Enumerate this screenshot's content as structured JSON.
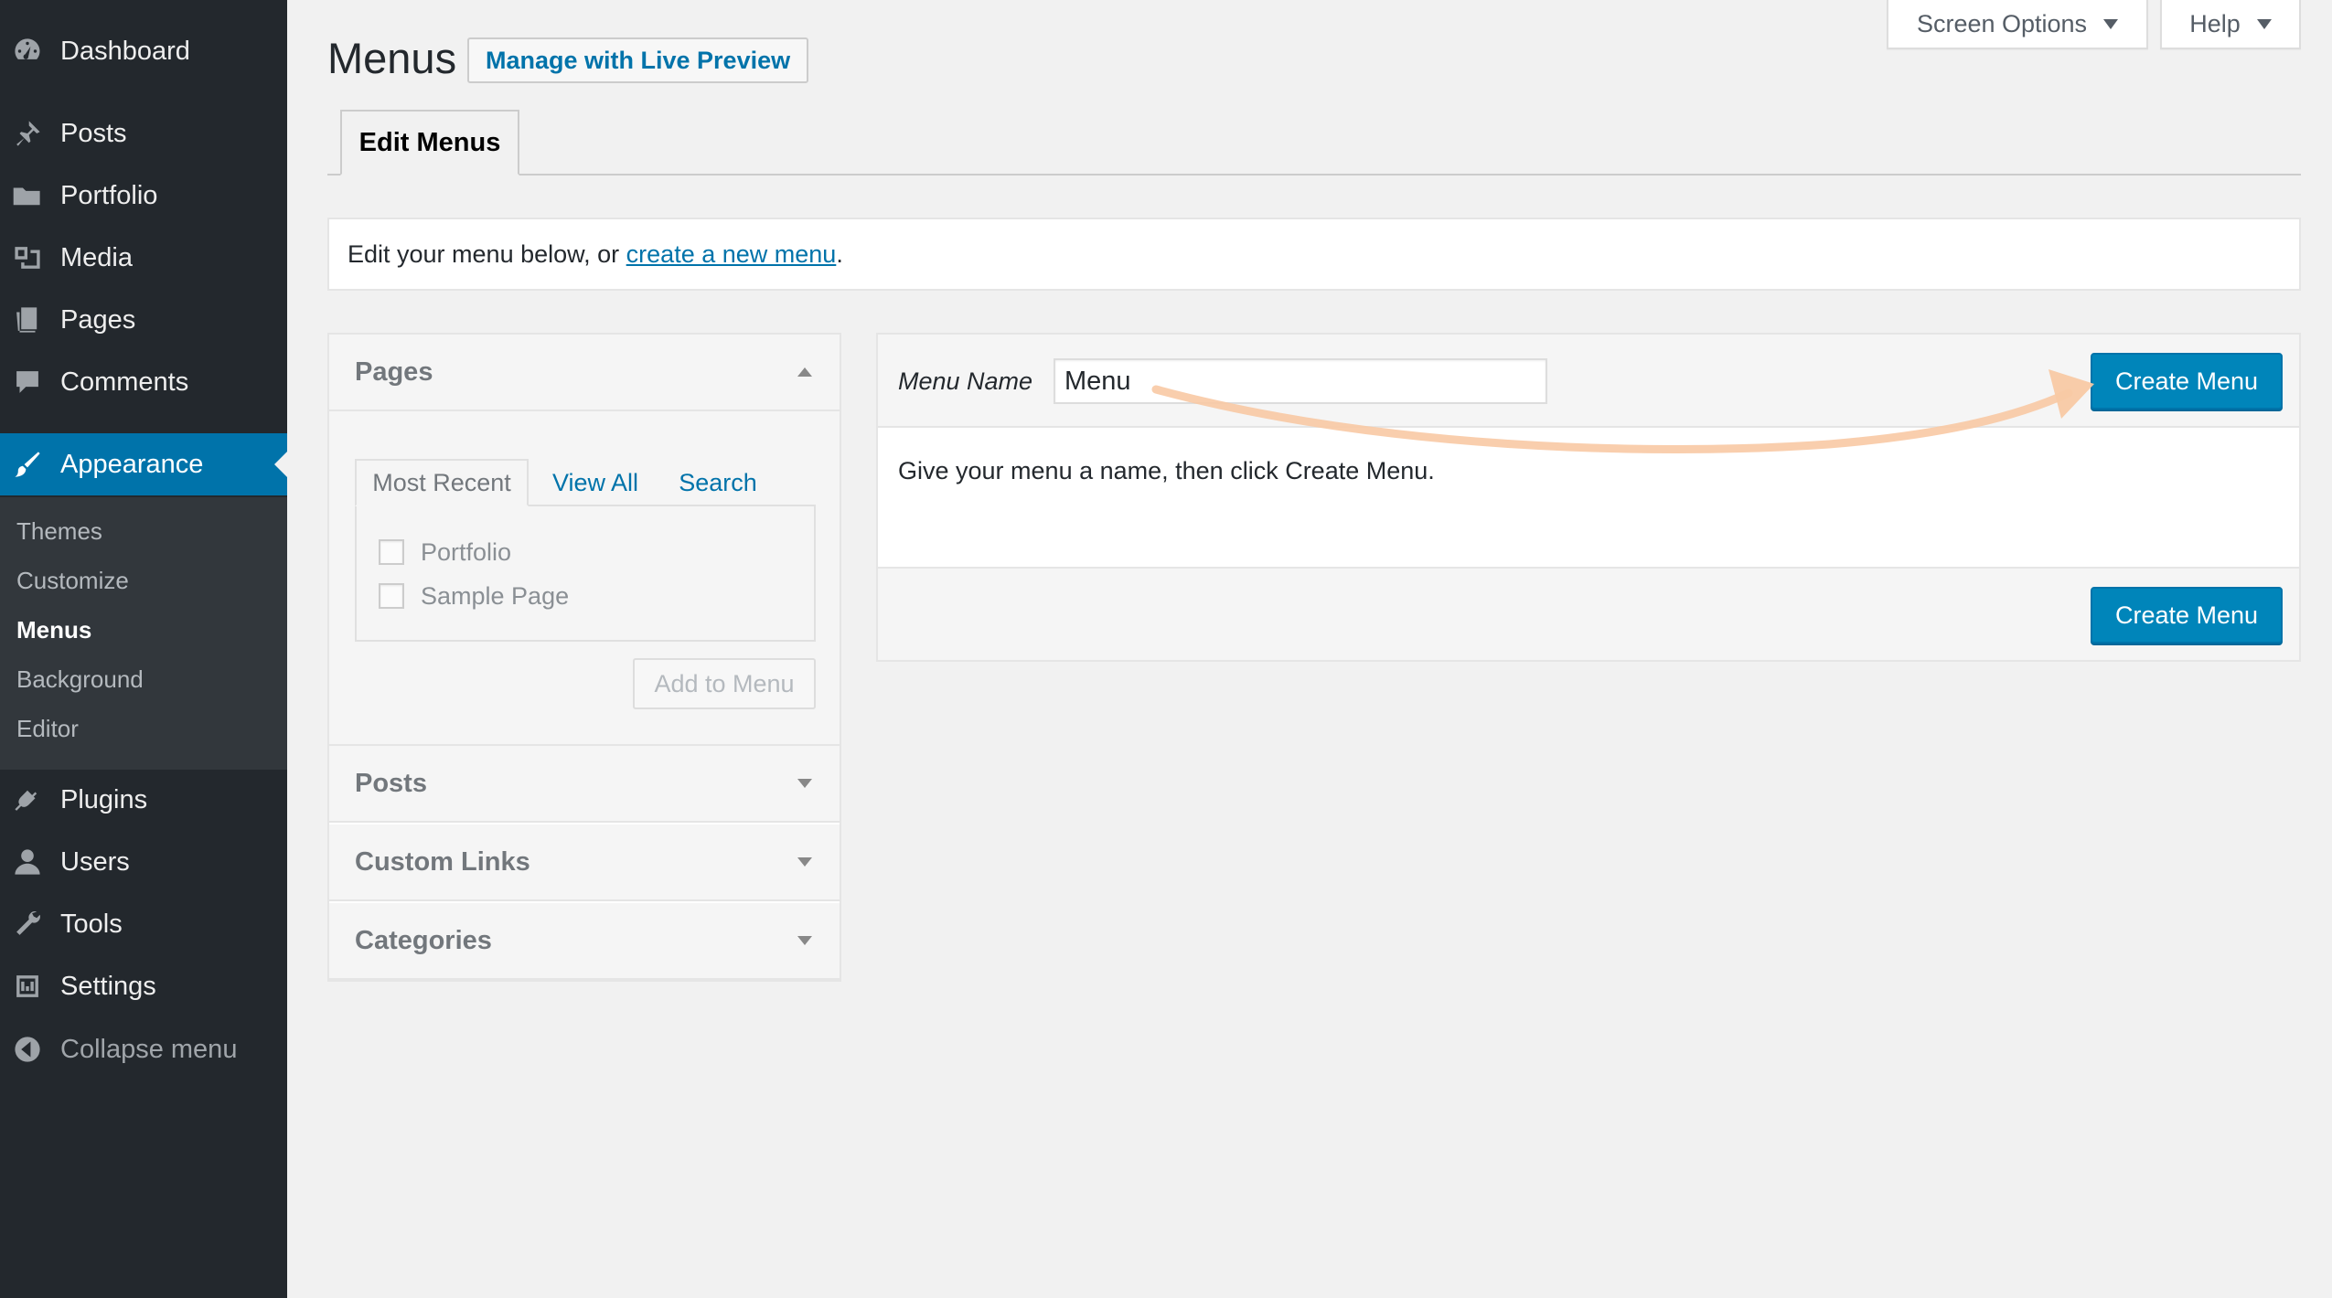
{
  "sidebar": {
    "items": [
      {
        "label": "Dashboard",
        "icon": "dashboard-icon"
      },
      {
        "label": "Posts",
        "icon": "pin-icon"
      },
      {
        "label": "Portfolio",
        "icon": "folder-icon"
      },
      {
        "label": "Media",
        "icon": "media-icon"
      },
      {
        "label": "Pages",
        "icon": "pages-icon"
      },
      {
        "label": "Comments",
        "icon": "comment-icon"
      },
      {
        "label": "Appearance",
        "icon": "brush-icon"
      },
      {
        "label": "Plugins",
        "icon": "plugin-icon"
      },
      {
        "label": "Users",
        "icon": "user-icon"
      },
      {
        "label": "Tools",
        "icon": "wrench-icon"
      },
      {
        "label": "Settings",
        "icon": "settings-icon"
      }
    ],
    "submenu": [
      "Themes",
      "Customize",
      "Menus",
      "Background",
      "Editor"
    ],
    "collapse_label": "Collapse menu"
  },
  "screen_meta": {
    "screen_options": "Screen Options",
    "help": "Help"
  },
  "header": {
    "title": "Menus",
    "live_preview": "Manage with Live Preview",
    "tab": "Edit Menus"
  },
  "notice": {
    "prefix": "Edit your menu below, or ",
    "link": "create a new menu",
    "suffix": "."
  },
  "accordion": {
    "pages_title": "Pages",
    "tabs": [
      "Most Recent",
      "View All",
      "Search"
    ],
    "checkboxes": [
      "Portfolio",
      "Sample Page"
    ],
    "add_button": "Add to Menu",
    "other_sections": [
      "Posts",
      "Custom Links",
      "Categories"
    ]
  },
  "editor": {
    "menu_name_label": "Menu Name",
    "menu_name_value": "Menu",
    "create_button": "Create Menu",
    "instructions": "Give your menu a name, then click Create Menu.",
    "create_button_bottom": "Create Menu"
  },
  "colors": {
    "sidebar_bg": "#23282d",
    "submenu_bg": "#32373c",
    "accent": "#0073aa",
    "primary_button": "#0085ba",
    "annotation": "#f8c9a4"
  }
}
